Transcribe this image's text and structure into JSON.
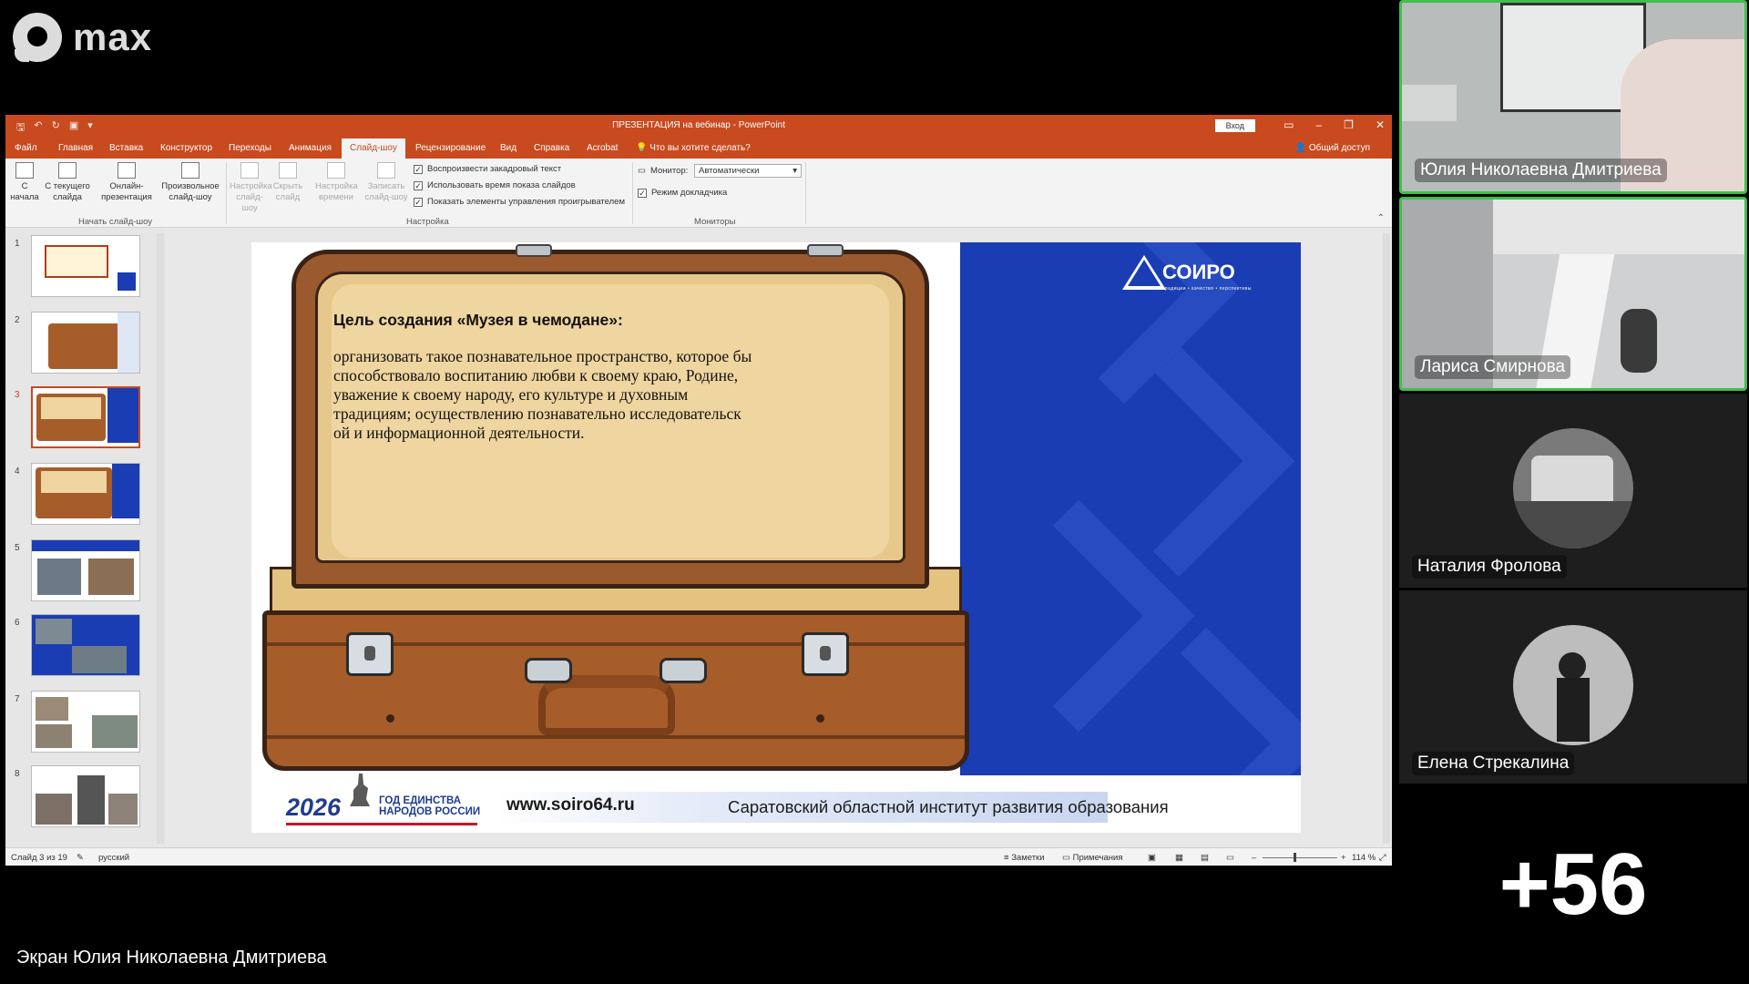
{
  "app": {
    "logo_text": "max"
  },
  "screen_label": "Экран Юлия Николаевна Дмитриева",
  "powerpoint": {
    "title": "ПРЕЗЕНТАЦИЯ на вебинар  -  PowerPoint",
    "login_button": "Вход",
    "share_label": "Общий доступ",
    "tabs": [
      "Файл",
      "Главная",
      "Вставка",
      "Конструктор",
      "Переходы",
      "Анимация",
      "Слайд-шоу",
      "Рецензирование",
      "Вид",
      "Справка",
      "Acrobat",
      "Что вы хотите сделать?"
    ],
    "active_tab": "Слайд-шоу",
    "ribbon": {
      "from_start": "С начала",
      "from_current": "С текущего слайда",
      "online": "Онлайн-презентация",
      "custom": "Произвольное слайд-шоу",
      "group_start": "Начать слайд-шоу",
      "setup": "Настройка слайд-шоу",
      "hide": "Скрыть слайд",
      "timing": "Настройка времени",
      "record": "Записать слайд-шоу",
      "chk_narration": "Воспроизвести закадровый текст",
      "chk_timings": "Использовать время показа слайдов",
      "chk_controls": "Показать элементы управления проигрывателем",
      "group_setup": "Настройка",
      "monitor_label": "Монитор:",
      "monitor_value": "Автоматически",
      "presenter_view": "Режим докладчика",
      "group_monitors": "Мониторы"
    },
    "thumbnails": [
      "1",
      "2",
      "3",
      "4",
      "5",
      "6",
      "7",
      "8"
    ],
    "selected_slide": 3,
    "slide": {
      "logo": "СОИРО",
      "logo_sub": "традиции • качество • перспективы",
      "goal_title": "Цель создания «Музея в чемодане»:",
      "goal_text": "организовать такое познавательное пространство, которое бы способствовало  воспитанию  любви к своему краю, Родине, уважение к своему народу, его культуре и духовным традициям; осуществлению познавательно исследовательск ой  и информационной  деятельности.",
      "year": "2026",
      "year_text_1": "ГОД ЕДИНСТВА",
      "year_text_2": "НАРОДОВ РОССИИ",
      "site": "www.soiro64.ru",
      "institute": "Саратовский областной институт развития образования"
    },
    "status": {
      "slide_counter": "Слайд 3 из 19",
      "language": "русский",
      "notes": "Заметки",
      "comments": "Примечания",
      "zoom": "114 %"
    }
  },
  "participants": [
    {
      "name": "Юлия Николаевна Дмитриева",
      "speaking": true
    },
    {
      "name": "Лариса Смирнова",
      "speaking": true
    },
    {
      "name": "Наталия Фролова",
      "speaking": false
    },
    {
      "name": "Елена Стрекалина",
      "speaking": false
    }
  ],
  "more_participants": "+56"
}
